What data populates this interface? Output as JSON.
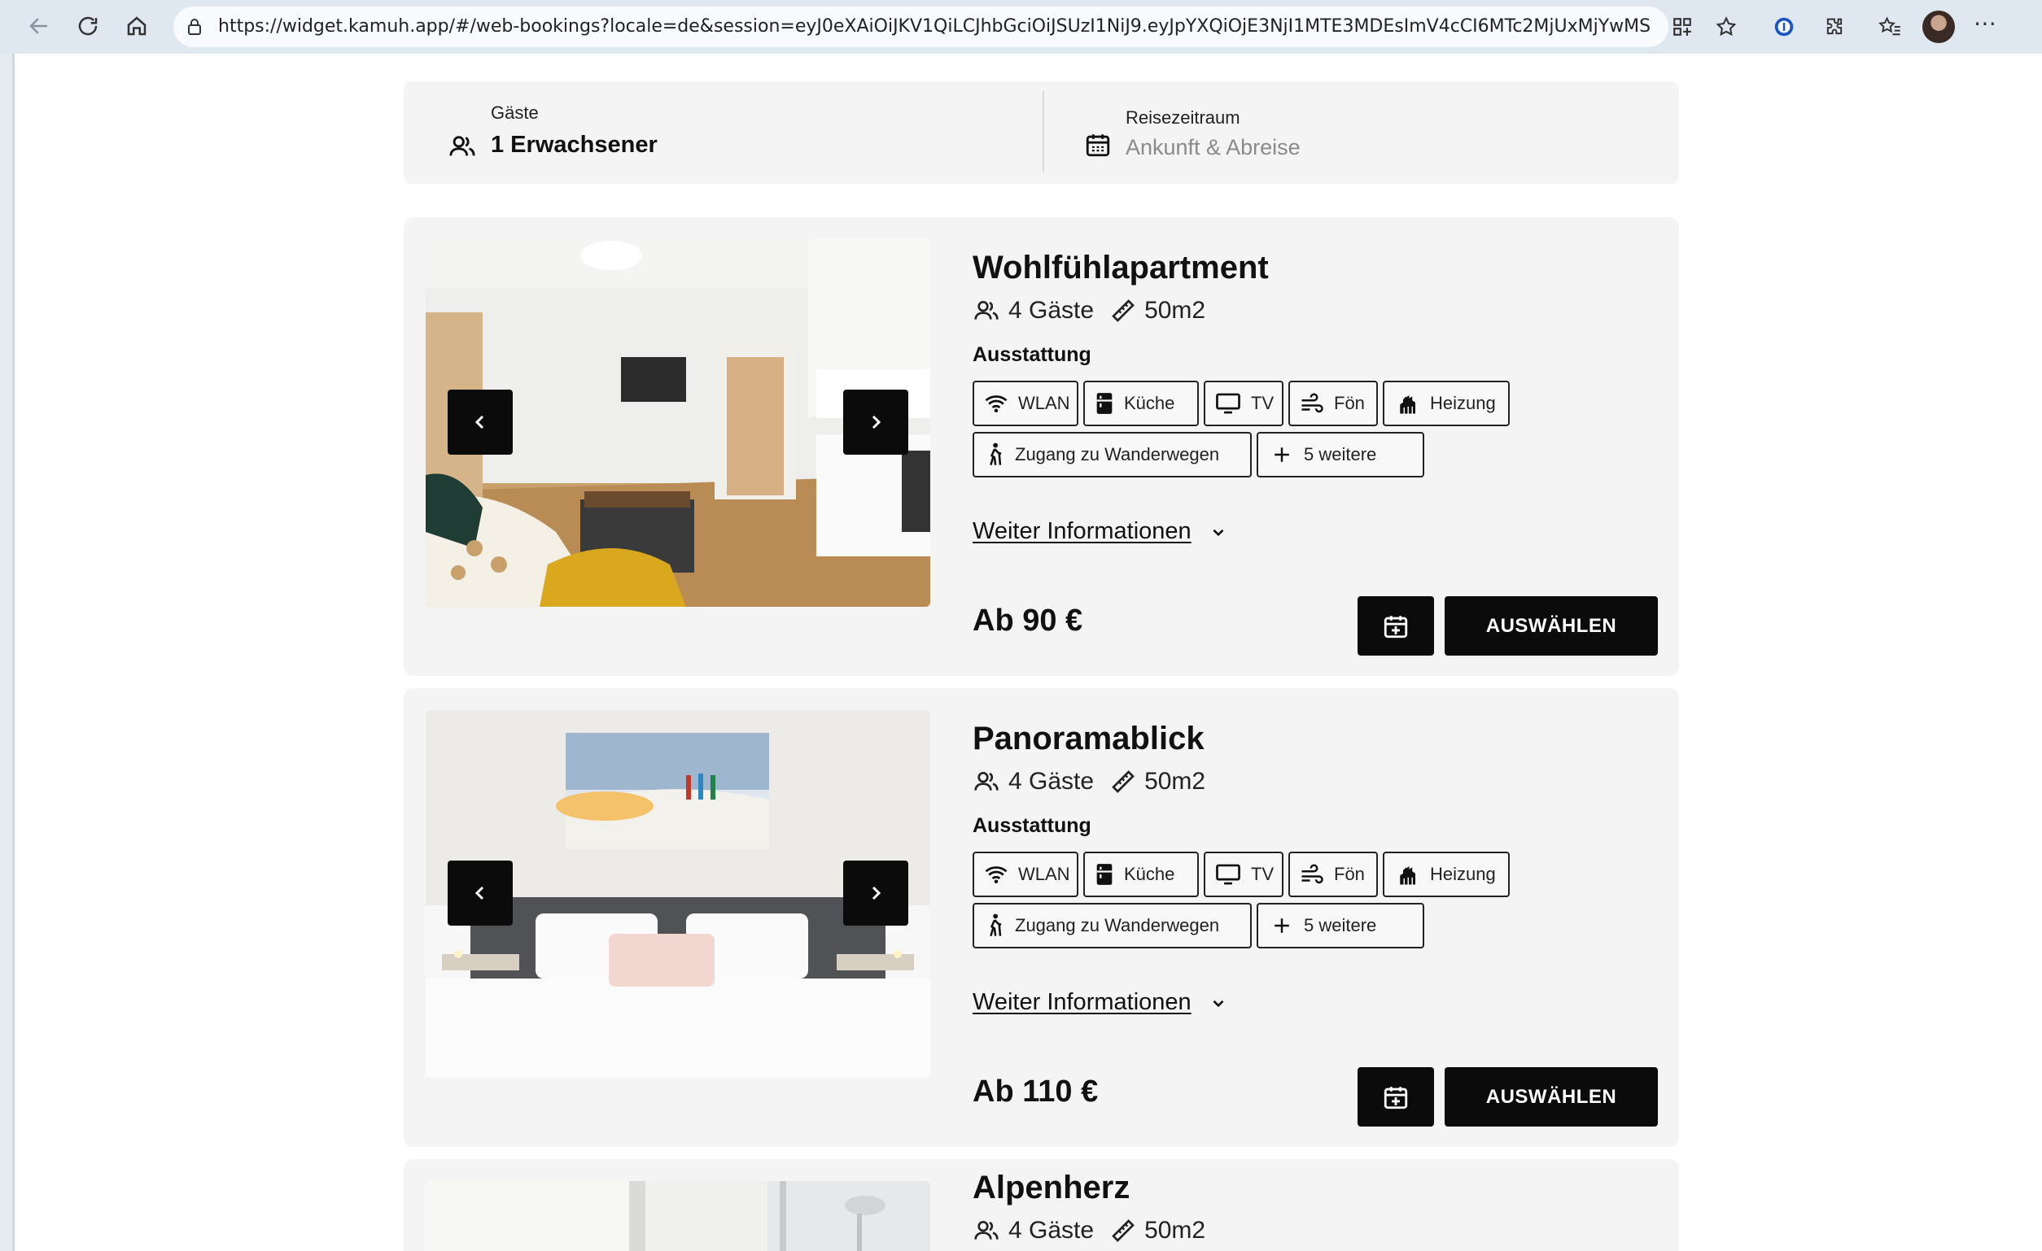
{
  "browser": {
    "url": "https://widget.kamuh.app/#/web-bookings?locale=de&session=eyJ0eXAiOiJKV1QiLCJhbGciOiJSUzI1NiJ9.eyJpYXQiOjE3NjI1MTE3MDEsImV4cCI6MTc2MjUxMjYwMSwidX..."
  },
  "filters": {
    "guests_label": "Gäste",
    "guests_value": "1 Erwachsener",
    "period_label": "Reisezeitraum",
    "period_placeholder": "Ankunft & Abreise"
  },
  "rooms": [
    {
      "title": "Wohlfühlapartment",
      "guests": "4 Gäste",
      "size": "50m2",
      "section_label": "Ausstattung",
      "amenities": [
        "WLAN",
        "Küche",
        "TV",
        "Fön",
        "Heizung",
        "Zugang zu Wanderwegen"
      ],
      "more_amenities": "5 weitere",
      "more_info": "Weiter Informationen",
      "price": "Ab 90 €",
      "select_label": "AUSWÄHLEN"
    },
    {
      "title": "Panoramablick",
      "guests": "4 Gäste",
      "size": "50m2",
      "section_label": "Ausstattung",
      "amenities": [
        "WLAN",
        "Küche",
        "TV",
        "Fön",
        "Heizung",
        "Zugang zu Wanderwegen"
      ],
      "more_amenities": "5 weitere",
      "more_info": "Weiter Informationen",
      "price": "Ab 110 €",
      "select_label": "AUSWÄHLEN"
    },
    {
      "title": "Alpenherz",
      "guests": "4 Gäste",
      "size": "50m2"
    }
  ],
  "colors": {
    "accent": "#0b0b0b",
    "card_bg": "#f4f4f4",
    "chrome_bg": "#dfe7f1"
  }
}
